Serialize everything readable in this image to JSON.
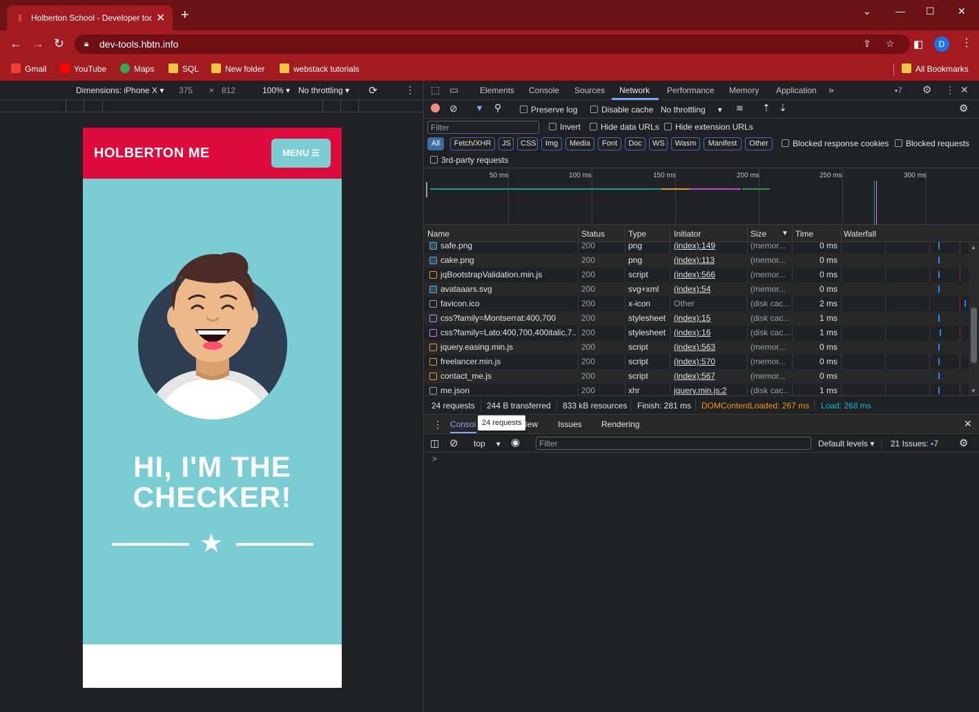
{
  "browser": {
    "tab_title": "Holberton School - Developer tools",
    "tab_close": "✕",
    "new_tab": "+",
    "url": "dev-tools.hbtn.info",
    "account_initial": "D",
    "bookmarks": [
      {
        "label": "Gmail"
      },
      {
        "label": "YouTube"
      },
      {
        "label": "Maps"
      },
      {
        "label": "SQL"
      },
      {
        "label": "New folder"
      },
      {
        "label": "webstack tutorials"
      }
    ],
    "all_bookmarks": "All Bookmarks"
  },
  "device_toolbar": {
    "dimensions": "Dimensions: iPhone X",
    "width": "375",
    "times": "×",
    "height": "812",
    "zoom": "100%",
    "throttling": "No throttling"
  },
  "phone": {
    "brand": "HOLBERTON ME",
    "menu": "MENU ☰",
    "hero_line1": "HI, I'M THE",
    "hero_line2": "CHECKER!",
    "colors": {
      "header": "#dd0a3b",
      "body": "#79cdd3"
    }
  },
  "devtools": {
    "tabs": [
      "Elements",
      "Console",
      "Sources",
      "Network",
      "Performance",
      "Memory",
      "Application"
    ],
    "active_tab": "Network",
    "issues_badge": "7",
    "toolbar": {
      "preserve_log": "Preserve log",
      "disable_cache": "Disable cache",
      "throttling": "No throttling"
    },
    "filter_placeholder": "Filter",
    "invert": "Invert",
    "hide_data_urls": "Hide data URLs",
    "hide_extension_urls": "Hide extension URLs",
    "type_filters": [
      "All",
      "Fetch/XHR",
      "JS",
      "CSS",
      "Img",
      "Media",
      "Font",
      "Doc",
      "WS",
      "Wasm",
      "Manifest",
      "Other"
    ],
    "blocked_response_cookies": "Blocked response cookies",
    "blocked_requests": "Blocked requests",
    "third_party": "3rd-party requests",
    "timeline_ticks": [
      "50 ms",
      "100 ms",
      "150 ms",
      "200 ms",
      "250 ms",
      "300 ms"
    ],
    "columns": [
      "Name",
      "Status",
      "Type",
      "Initiator",
      "Size",
      "Time",
      "Waterfall"
    ],
    "rows": [
      {
        "name": "safe.png",
        "status": "200",
        "type": "png",
        "initiator": "(index):149",
        "size": "(memor...",
        "time": "0 ms",
        "icon": "img"
      },
      {
        "name": "cake.png",
        "status": "200",
        "type": "png",
        "initiator": "(index):113",
        "size": "(memor...",
        "time": "0 ms",
        "icon": "img"
      },
      {
        "name": "jqBootstrapValidation.min.js",
        "status": "200",
        "type": "script",
        "initiator": "(index):566",
        "size": "(memor...",
        "time": "0 ms",
        "icon": "script"
      },
      {
        "name": "avataaars.svg",
        "status": "200",
        "type": "svg+xml",
        "initiator": "(index):54",
        "size": "(memor...",
        "time": "0 ms",
        "icon": "img"
      },
      {
        "name": "favicon.ico",
        "status": "200",
        "type": "x-icon",
        "initiator": "Other",
        "size": "(disk cac...",
        "time": "2 ms",
        "icon": "doc"
      },
      {
        "name": "css?family=Montserrat:400,700",
        "status": "200",
        "type": "stylesheet",
        "initiator": "(index):15",
        "size": "(disk cac...",
        "time": "1 ms",
        "icon": "css"
      },
      {
        "name": "css?family=Lato:400,700,400italic,7...",
        "status": "200",
        "type": "stylesheet",
        "initiator": "(index):16",
        "size": "(disk cac...",
        "time": "1 ms",
        "icon": "css"
      },
      {
        "name": "jquery.easing.min.js",
        "status": "200",
        "type": "script",
        "initiator": "(index):563",
        "size": "(memor...",
        "time": "0 ms",
        "icon": "script"
      },
      {
        "name": "freelancer.min.js",
        "status": "200",
        "type": "script",
        "initiator": "(index):570",
        "size": "(memor...",
        "time": "0 ms",
        "icon": "script"
      },
      {
        "name": "contact_me.js",
        "status": "200",
        "type": "script",
        "initiator": "(index):567",
        "size": "(memor...",
        "time": "0 ms",
        "icon": "script"
      },
      {
        "name": "me.json",
        "status": "200",
        "type": "xhr",
        "initiator": "jquery.min.js:2",
        "size": "(disk cac...",
        "time": "1 ms",
        "icon": "doc"
      }
    ],
    "summary": {
      "requests": "24 requests",
      "transferred": "244 B transferred",
      "resources": "833 kB resources",
      "finish": "Finish: 281 ms",
      "dcl": "DOMContentLoaded: 267 ms",
      "load": "Load: 268 ms"
    },
    "drawer": {
      "tabs": [
        "Console",
        "What's New",
        "Issues",
        "Rendering"
      ],
      "tooltip": "24 requests",
      "context": "top",
      "filter_placeholder": "Filter",
      "levels": "Default levels",
      "issues": "21 Issues:",
      "issues_count": "7",
      "prompt": ">"
    }
  }
}
